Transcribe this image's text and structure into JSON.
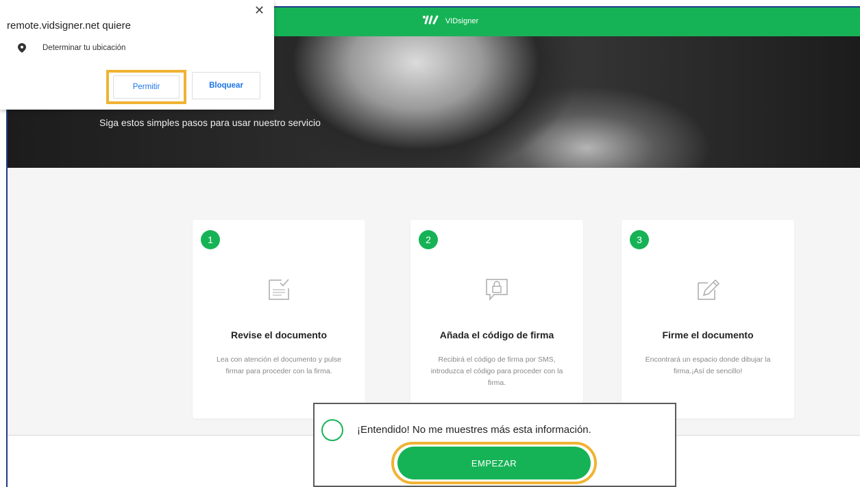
{
  "colors": {
    "brand": "#16b356",
    "highlight": "#f0b332",
    "link": "#1a73e8"
  },
  "header": {
    "brand_name": "VIDsigner",
    "logo_icon": "vidsigner-logo-icon"
  },
  "hero": {
    "subtitle": "Siga estos simples pasos para usar nuestro servicio"
  },
  "steps": [
    {
      "number": "1",
      "icon": "document-check-icon",
      "title": "Revise el documento",
      "description": "Lea con atención el documento y pulse firmar para proceder con la firma."
    },
    {
      "number": "2",
      "icon": "lock-message-icon",
      "title": "Añada el código de firma",
      "description": "Recibirá el código de firma por SMS, introduzca el código para proceder con la firma."
    },
    {
      "number": "3",
      "icon": "pencil-sign-icon",
      "title": "Firme el documento",
      "description": "Encontrará un espacio donde dibujar la firma.¡Así de sencillo!"
    }
  ],
  "consent": {
    "checkbox_label": "¡Entendido! No me muestres más esta información.",
    "start_button": "EMPEZAR"
  },
  "permission_popup": {
    "origin": "remote.vidsigner.net quiere",
    "request": "Determinar tu ubicación",
    "allow_button": "Permitir",
    "block_button": "Bloquear",
    "close_icon": "close-icon",
    "location_icon": "location-pin-icon"
  }
}
